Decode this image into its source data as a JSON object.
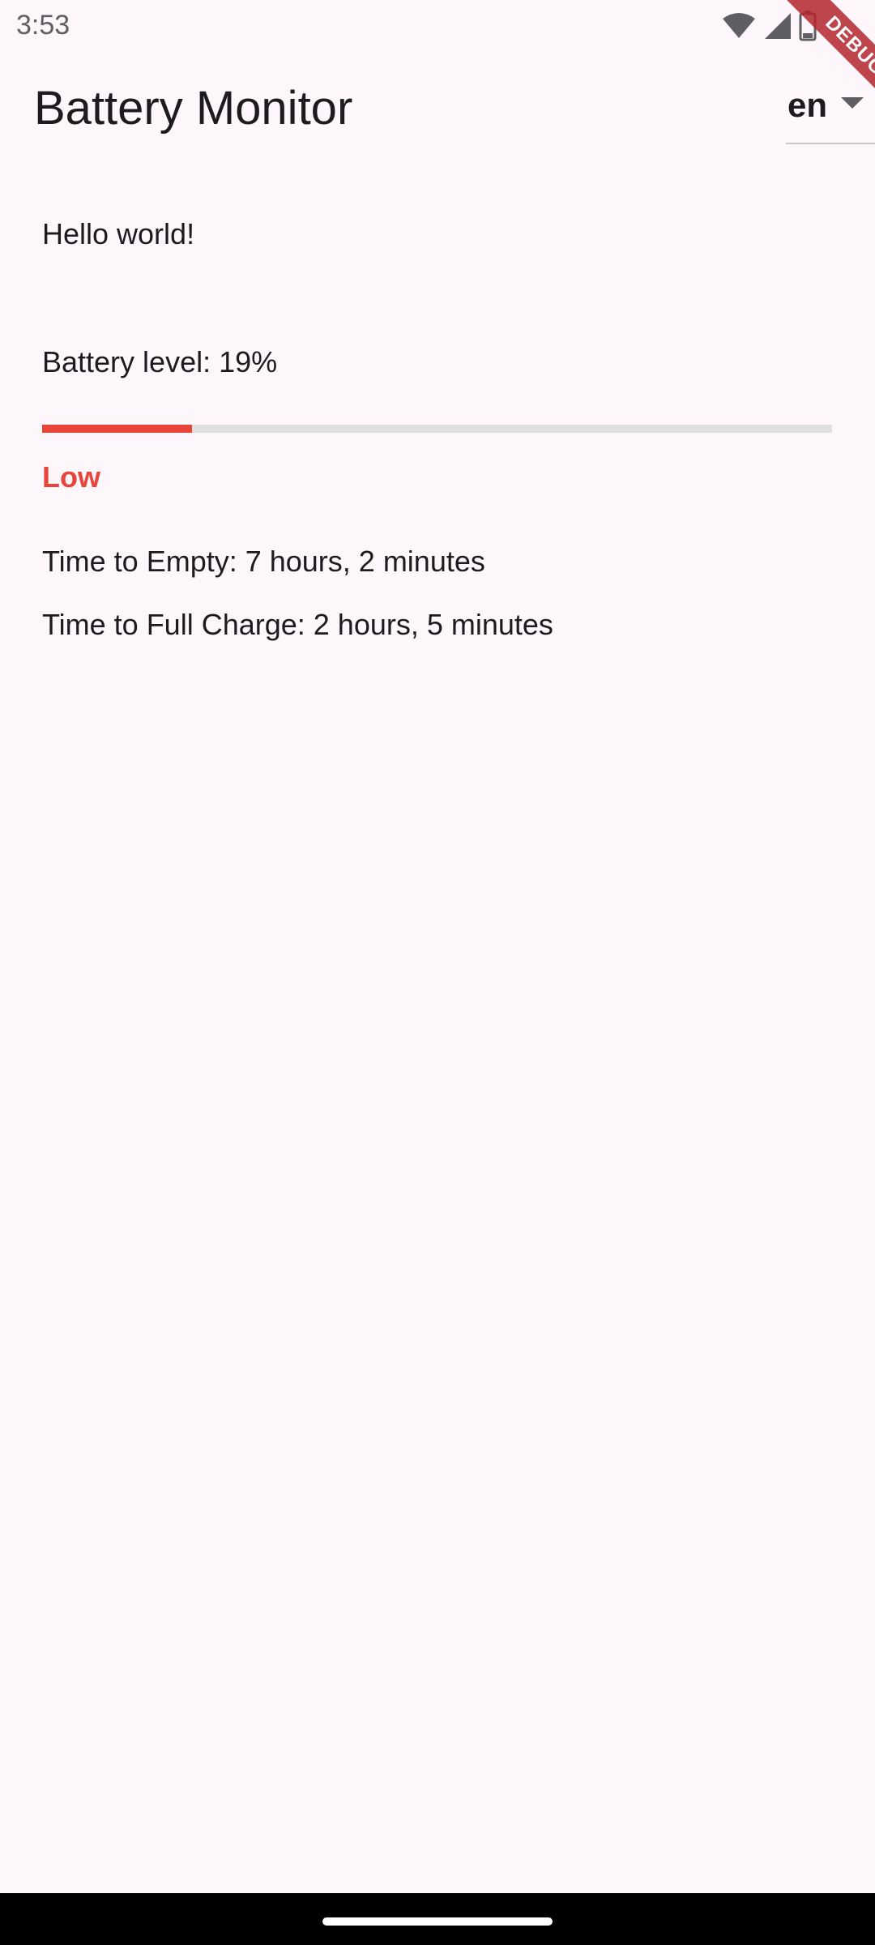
{
  "status_bar": {
    "time": "3:53",
    "icons": [
      "wifi-icon",
      "cellular-signal-icon",
      "battery-icon"
    ]
  },
  "app_bar": {
    "title": "Battery Monitor",
    "language_selected": "en"
  },
  "debug_banner": {
    "label": "DEBUG"
  },
  "main": {
    "greeting": "Hello world!",
    "battery_level_text": "Battery level: 19%",
    "battery_level_percent": 19,
    "battery_status": "Low",
    "time_to_empty": "Time to Empty: 7 hours, 2 minutes",
    "time_to_full": "Time to Full Charge: 2 hours, 5 minutes"
  },
  "colors": {
    "background": "#fdf7fb",
    "low_status": "#e8443a",
    "progress_track": "#e0e0e0",
    "debug_ribbon": "#b3262d"
  }
}
